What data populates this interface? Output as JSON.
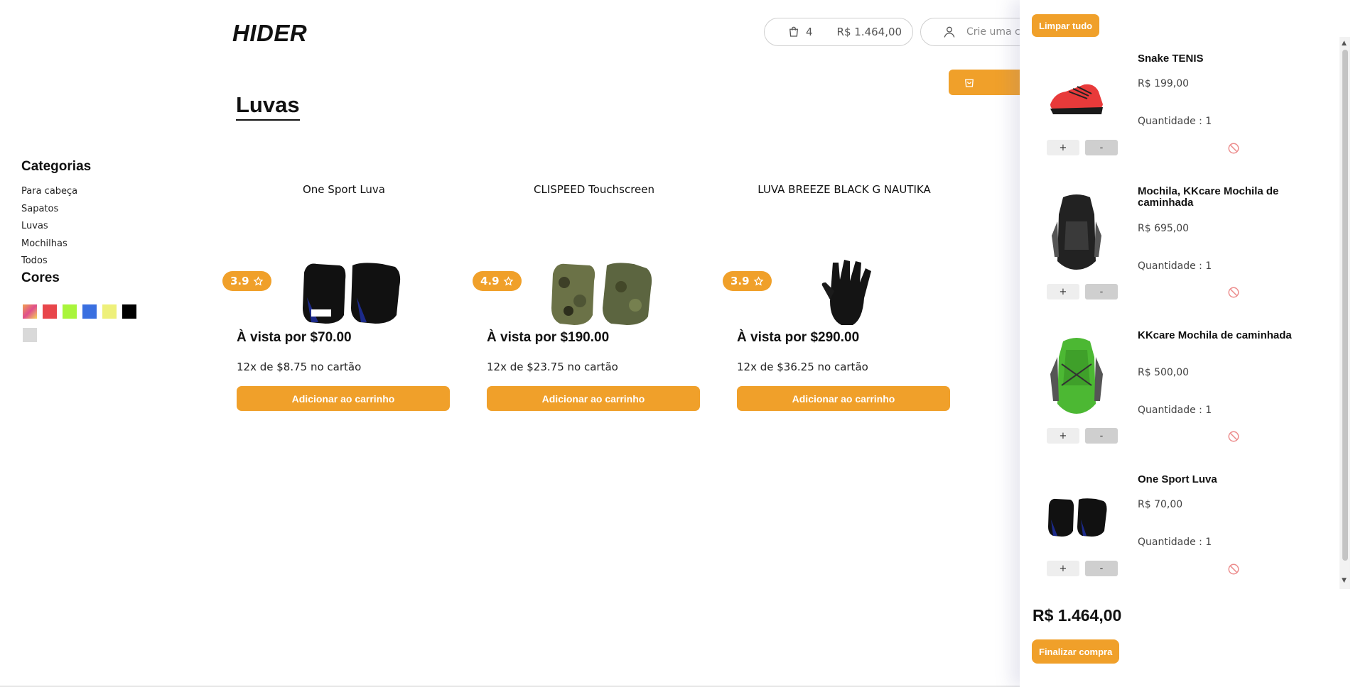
{
  "header": {
    "logo": "HIDER",
    "cart_count": "4",
    "cart_total": "R$ 1.464,00",
    "account_text": "Crie uma co"
  },
  "page": {
    "title": "Luvas"
  },
  "sidebar": {
    "categories_title": "Categorias",
    "categories": [
      "Para cabeça",
      "Sapatos",
      "Luvas",
      "Mochilhas",
      "Todos"
    ],
    "colors_title": "Cores",
    "colors": [
      "gradient",
      "#e8464b",
      "#a9f53b",
      "#3a6fe0",
      "#eef07a",
      "#000000",
      "#d9d9d9"
    ]
  },
  "products": [
    {
      "name": "One Sport Luva",
      "rating": "3.9",
      "price": "À vista por $70.00",
      "installments": "12x de $8.75 no cartão",
      "button": "Adicionar ao carrinho"
    },
    {
      "name": "CLISPEED Touchscreen",
      "rating": "4.9",
      "price": "À vista por $190.00",
      "installments": "12x de $23.75 no cartão",
      "button": "Adicionar ao carrinho"
    },
    {
      "name": "LUVA BREEZE BLACK G NAUTIKA",
      "rating": "3.9",
      "price": "À vista por $290.00",
      "installments": "12x de $36.25 no cartão",
      "button": "Adicionar ao carrinho"
    }
  ],
  "cart": {
    "clear_label": "Limpar tudo",
    "items": [
      {
        "name": "Snake TENIS",
        "price": "R$ 199,00",
        "quantity": "Quantidade : 1",
        "plus": "+",
        "minus": "-"
      },
      {
        "name": "Mochila, KKcare Mochila de caminhada",
        "price": "R$ 695,00",
        "quantity": "Quantidade : 1",
        "plus": "+",
        "minus": "-"
      },
      {
        "name": "KKcare Mochila de caminhada",
        "price": "R$ 500,00",
        "quantity": "Quantidade : 1",
        "plus": "+",
        "minus": "-"
      },
      {
        "name": "One Sport Luva",
        "price": "R$ 70,00",
        "quantity": "Quantidade : 1",
        "plus": "+",
        "minus": "-"
      }
    ],
    "total": "R$ 1.464,00",
    "checkout_label": "Finalizar compra"
  },
  "colors": {
    "accent": "#f0a02a",
    "remove_icon": "#ec8b8b"
  }
}
